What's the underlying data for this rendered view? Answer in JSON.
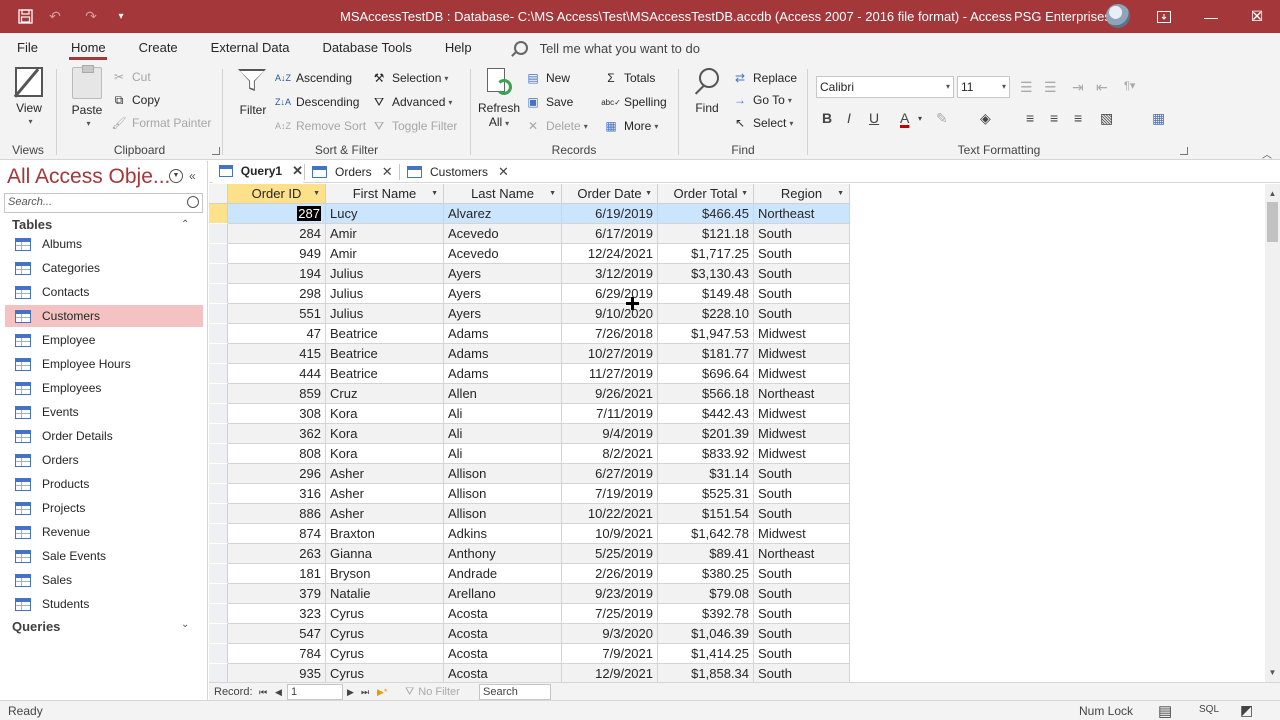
{
  "titlebar": {
    "title": "MSAccessTestDB : Database- C:\\MS Access\\Test\\MSAccessTestDB.accdb (Access 2007 - 2016 file format)  -  Access",
    "user": "PSG Enterprises",
    "save_icon": "save-icon",
    "undo_icon": "undo-icon",
    "redo_icon": "redo-icon",
    "customize_icon": "customize-qat-icon",
    "minimize": "—",
    "restore": "☐",
    "close": "✕",
    "accent": "#a4373a"
  },
  "ribbon_tabs": [
    "File",
    "Home",
    "Create",
    "External Data",
    "Database Tools",
    "Help"
  ],
  "active_tab": "Home",
  "tell_me": "Tell me what you want to do",
  "ribbon": {
    "views": {
      "view": "View",
      "label": "Views"
    },
    "clipboard": {
      "paste": "Paste",
      "cut": "Cut",
      "copy": "Copy",
      "format_painter": "Format Painter",
      "label": "Clipboard"
    },
    "sort_filter": {
      "filter": "Filter",
      "ascending": "Ascending",
      "descending": "Descending",
      "remove_sort": "Remove Sort",
      "selection": "Selection",
      "advanced": "Advanced",
      "toggle_filter": "Toggle Filter",
      "label": "Sort & Filter"
    },
    "records": {
      "refresh": "Refresh",
      "all": "All",
      "new": "New",
      "save": "Save",
      "delete": "Delete",
      "totals": "Totals",
      "spelling": "Spelling",
      "more": "More",
      "label": "Records"
    },
    "find": {
      "find": "Find",
      "replace": "Replace",
      "goto": "Go To",
      "select": "Select",
      "label": "Find"
    },
    "text_formatting": {
      "font": "Calibri",
      "size": "11",
      "bold": "B",
      "italic": "I",
      "underline": "U",
      "label": "Text Formatting",
      "font_color": "#c00000"
    }
  },
  "nav": {
    "title": "All Access Obje...",
    "search_placeholder": "Search...",
    "tables_header": "Tables",
    "queries_header": "Queries",
    "tables": [
      "Albums",
      "Categories",
      "Contacts",
      "Customers",
      "Employee",
      "Employee Hours",
      "Employees",
      "Events",
      "Order Details",
      "Orders",
      "Products",
      "Projects",
      "Revenue",
      "Sale Events",
      "Sales",
      "Students"
    ],
    "selected": "Customers",
    "selected_color": "#f4c2c2"
  },
  "doc_tabs": [
    {
      "label": "Query1",
      "active": true
    },
    {
      "label": "Orders",
      "active": false
    },
    {
      "label": "Customers",
      "active": false
    }
  ],
  "sheet": {
    "columns": [
      "Order ID",
      "First Name",
      "Last Name",
      "Order Date",
      "Order Total",
      "Region"
    ],
    "rows": [
      [
        "287",
        "Lucy",
        "Alvarez",
        "6/19/2019",
        "$466.45",
        "Northeast"
      ],
      [
        "284",
        "Amir",
        "Acevedo",
        "6/17/2019",
        "$121.18",
        "South"
      ],
      [
        "949",
        "Amir",
        "Acevedo",
        "12/24/2021",
        "$1,717.25",
        "South"
      ],
      [
        "194",
        "Julius",
        "Ayers",
        "3/12/2019",
        "$3,130.43",
        "South"
      ],
      [
        "298",
        "Julius",
        "Ayers",
        "6/29/2019",
        "$149.48",
        "South"
      ],
      [
        "551",
        "Julius",
        "Ayers",
        "9/10/2020",
        "$228.10",
        "South"
      ],
      [
        "47",
        "Beatrice",
        "Adams",
        "7/26/2018",
        "$1,947.53",
        "Midwest"
      ],
      [
        "415",
        "Beatrice",
        "Adams",
        "10/27/2019",
        "$181.77",
        "Midwest"
      ],
      [
        "444",
        "Beatrice",
        "Adams",
        "11/27/2019",
        "$696.64",
        "Midwest"
      ],
      [
        "859",
        "Cruz",
        "Allen",
        "9/26/2021",
        "$566.18",
        "Northeast"
      ],
      [
        "308",
        "Kora",
        "Ali",
        "7/11/2019",
        "$442.43",
        "Midwest"
      ],
      [
        "362",
        "Kora",
        "Ali",
        "9/4/2019",
        "$201.39",
        "Midwest"
      ],
      [
        "808",
        "Kora",
        "Ali",
        "8/2/2021",
        "$833.92",
        "Midwest"
      ],
      [
        "296",
        "Asher",
        "Allison",
        "6/27/2019",
        "$31.14",
        "South"
      ],
      [
        "316",
        "Asher",
        "Allison",
        "7/19/2019",
        "$525.31",
        "South"
      ],
      [
        "886",
        "Asher",
        "Allison",
        "10/22/2021",
        "$151.54",
        "South"
      ],
      [
        "874",
        "Braxton",
        "Adkins",
        "10/9/2021",
        "$1,642.78",
        "Midwest"
      ],
      [
        "263",
        "Gianna",
        "Anthony",
        "5/25/2019",
        "$89.41",
        "Northeast"
      ],
      [
        "181",
        "Bryson",
        "Andrade",
        "2/26/2019",
        "$380.25",
        "South"
      ],
      [
        "379",
        "Natalie",
        "Arellano",
        "9/23/2019",
        "$79.08",
        "South"
      ],
      [
        "323",
        "Cyrus",
        "Acosta",
        "7/25/2019",
        "$392.78",
        "South"
      ],
      [
        "547",
        "Cyrus",
        "Acosta",
        "9/3/2020",
        "$1,046.39",
        "South"
      ],
      [
        "784",
        "Cyrus",
        "Acosta",
        "7/9/2021",
        "$1,414.25",
        "South"
      ],
      [
        "935",
        "Cyrus",
        "Acosta",
        "12/9/2021",
        "$1,858.34",
        "South"
      ]
    ],
    "current_row": 0
  },
  "record_nav": {
    "label": "Record:",
    "first": "⏮",
    "prev": "◀",
    "current": "1",
    "next": "▶",
    "last": "⏭",
    "new": "▶*",
    "no_filter": "No Filter",
    "search": "Search"
  },
  "status": {
    "left": "Ready",
    "num_lock": "Num Lock",
    "sql": "SQL"
  }
}
